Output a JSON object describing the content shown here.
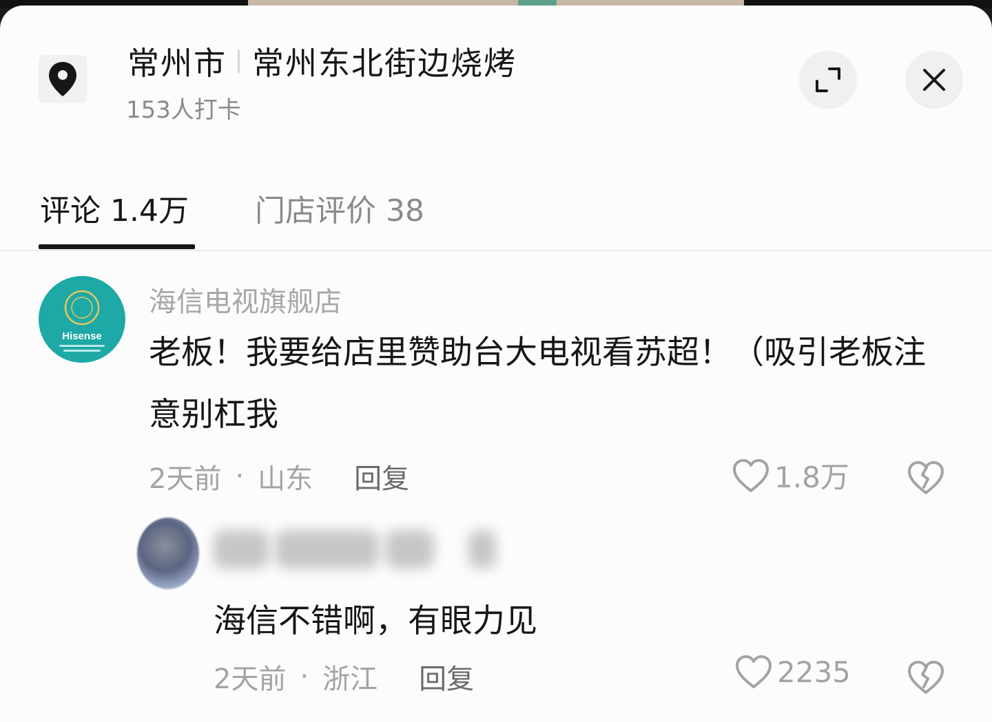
{
  "header": {
    "city": "常州市",
    "shop_name": "常州东北街边烧烤",
    "checkin_count": "153人打卡"
  },
  "tabs": [
    {
      "label": "评论 1.4万",
      "active": true
    },
    {
      "label": "门店评价 38",
      "active": false
    }
  ],
  "comments": [
    {
      "username": "海信电视旗舰店",
      "avatar_logo": "Hisense",
      "text": "老板！我要给店里赞助台大电视看苏超！（吸引老板注意别杠我",
      "time": "2天前",
      "location": "山东",
      "reply_label": "回复",
      "likes": "1.8万"
    }
  ],
  "replies": [
    {
      "username_blurred": true,
      "text": "海信不错啊，有眼力见",
      "time": "2天前",
      "location": "浙江",
      "reply_label": "回复",
      "likes": "2235"
    }
  ],
  "colors": {
    "primary_text": "#161616",
    "secondary_text": "#a3a3a3",
    "hisense_teal": "#1ea9a6",
    "tab_underline": "#161616"
  },
  "icons": [
    "location-pin-icon",
    "expand-icon",
    "close-icon",
    "heart-icon",
    "broken-heart-icon"
  ]
}
